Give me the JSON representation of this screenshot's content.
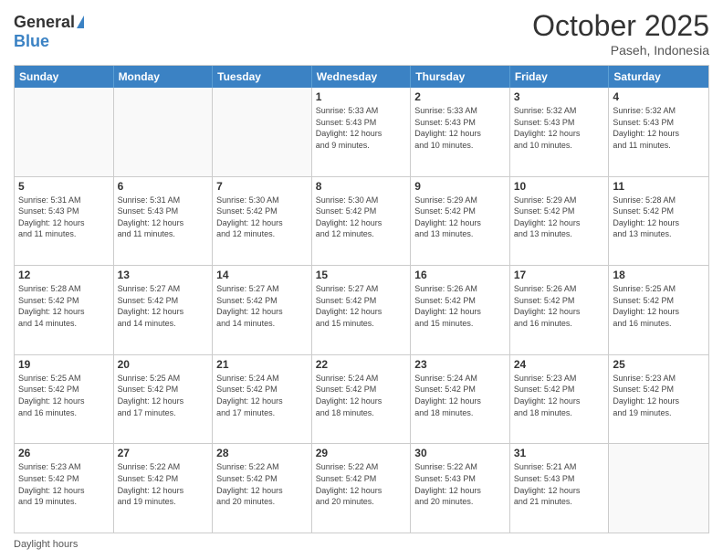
{
  "header": {
    "logo_general": "General",
    "logo_blue": "Blue",
    "month": "October 2025",
    "location": "Paseh, Indonesia"
  },
  "days_of_week": [
    "Sunday",
    "Monday",
    "Tuesday",
    "Wednesday",
    "Thursday",
    "Friday",
    "Saturday"
  ],
  "weeks": [
    [
      {
        "day": "",
        "info": ""
      },
      {
        "day": "",
        "info": ""
      },
      {
        "day": "",
        "info": ""
      },
      {
        "day": "1",
        "info": "Sunrise: 5:33 AM\nSunset: 5:43 PM\nDaylight: 12 hours\nand 9 minutes."
      },
      {
        "day": "2",
        "info": "Sunrise: 5:33 AM\nSunset: 5:43 PM\nDaylight: 12 hours\nand 10 minutes."
      },
      {
        "day": "3",
        "info": "Sunrise: 5:32 AM\nSunset: 5:43 PM\nDaylight: 12 hours\nand 10 minutes."
      },
      {
        "day": "4",
        "info": "Sunrise: 5:32 AM\nSunset: 5:43 PM\nDaylight: 12 hours\nand 11 minutes."
      }
    ],
    [
      {
        "day": "5",
        "info": "Sunrise: 5:31 AM\nSunset: 5:43 PM\nDaylight: 12 hours\nand 11 minutes."
      },
      {
        "day": "6",
        "info": "Sunrise: 5:31 AM\nSunset: 5:43 PM\nDaylight: 12 hours\nand 11 minutes."
      },
      {
        "day": "7",
        "info": "Sunrise: 5:30 AM\nSunset: 5:42 PM\nDaylight: 12 hours\nand 12 minutes."
      },
      {
        "day": "8",
        "info": "Sunrise: 5:30 AM\nSunset: 5:42 PM\nDaylight: 12 hours\nand 12 minutes."
      },
      {
        "day": "9",
        "info": "Sunrise: 5:29 AM\nSunset: 5:42 PM\nDaylight: 12 hours\nand 13 minutes."
      },
      {
        "day": "10",
        "info": "Sunrise: 5:29 AM\nSunset: 5:42 PM\nDaylight: 12 hours\nand 13 minutes."
      },
      {
        "day": "11",
        "info": "Sunrise: 5:28 AM\nSunset: 5:42 PM\nDaylight: 12 hours\nand 13 minutes."
      }
    ],
    [
      {
        "day": "12",
        "info": "Sunrise: 5:28 AM\nSunset: 5:42 PM\nDaylight: 12 hours\nand 14 minutes."
      },
      {
        "day": "13",
        "info": "Sunrise: 5:27 AM\nSunset: 5:42 PM\nDaylight: 12 hours\nand 14 minutes."
      },
      {
        "day": "14",
        "info": "Sunrise: 5:27 AM\nSunset: 5:42 PM\nDaylight: 12 hours\nand 14 minutes."
      },
      {
        "day": "15",
        "info": "Sunrise: 5:27 AM\nSunset: 5:42 PM\nDaylight: 12 hours\nand 15 minutes."
      },
      {
        "day": "16",
        "info": "Sunrise: 5:26 AM\nSunset: 5:42 PM\nDaylight: 12 hours\nand 15 minutes."
      },
      {
        "day": "17",
        "info": "Sunrise: 5:26 AM\nSunset: 5:42 PM\nDaylight: 12 hours\nand 16 minutes."
      },
      {
        "day": "18",
        "info": "Sunrise: 5:25 AM\nSunset: 5:42 PM\nDaylight: 12 hours\nand 16 minutes."
      }
    ],
    [
      {
        "day": "19",
        "info": "Sunrise: 5:25 AM\nSunset: 5:42 PM\nDaylight: 12 hours\nand 16 minutes."
      },
      {
        "day": "20",
        "info": "Sunrise: 5:25 AM\nSunset: 5:42 PM\nDaylight: 12 hours\nand 17 minutes."
      },
      {
        "day": "21",
        "info": "Sunrise: 5:24 AM\nSunset: 5:42 PM\nDaylight: 12 hours\nand 17 minutes."
      },
      {
        "day": "22",
        "info": "Sunrise: 5:24 AM\nSunset: 5:42 PM\nDaylight: 12 hours\nand 18 minutes."
      },
      {
        "day": "23",
        "info": "Sunrise: 5:24 AM\nSunset: 5:42 PM\nDaylight: 12 hours\nand 18 minutes."
      },
      {
        "day": "24",
        "info": "Sunrise: 5:23 AM\nSunset: 5:42 PM\nDaylight: 12 hours\nand 18 minutes."
      },
      {
        "day": "25",
        "info": "Sunrise: 5:23 AM\nSunset: 5:42 PM\nDaylight: 12 hours\nand 19 minutes."
      }
    ],
    [
      {
        "day": "26",
        "info": "Sunrise: 5:23 AM\nSunset: 5:42 PM\nDaylight: 12 hours\nand 19 minutes."
      },
      {
        "day": "27",
        "info": "Sunrise: 5:22 AM\nSunset: 5:42 PM\nDaylight: 12 hours\nand 19 minutes."
      },
      {
        "day": "28",
        "info": "Sunrise: 5:22 AM\nSunset: 5:42 PM\nDaylight: 12 hours\nand 20 minutes."
      },
      {
        "day": "29",
        "info": "Sunrise: 5:22 AM\nSunset: 5:42 PM\nDaylight: 12 hours\nand 20 minutes."
      },
      {
        "day": "30",
        "info": "Sunrise: 5:22 AM\nSunset: 5:43 PM\nDaylight: 12 hours\nand 20 minutes."
      },
      {
        "day": "31",
        "info": "Sunrise: 5:21 AM\nSunset: 5:43 PM\nDaylight: 12 hours\nand 21 minutes."
      },
      {
        "day": "",
        "info": ""
      }
    ]
  ],
  "footer": {
    "daylight_hours": "Daylight hours"
  }
}
